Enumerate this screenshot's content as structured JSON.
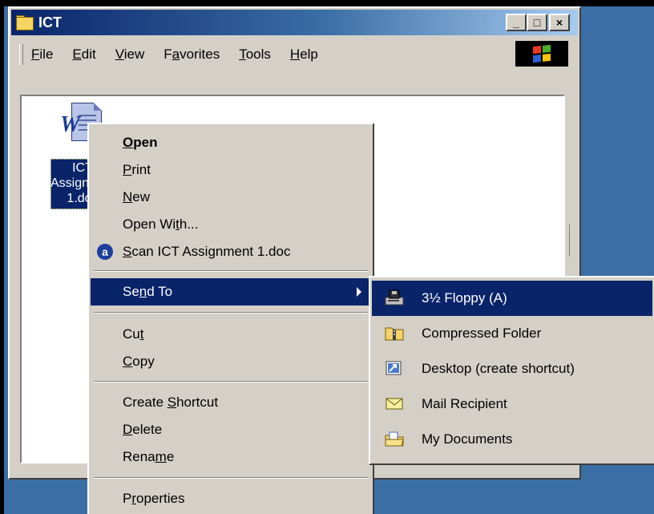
{
  "window": {
    "title": "ICT",
    "buttons": {
      "minimize": "_",
      "maximize": "□",
      "close": "×"
    }
  },
  "menubar": {
    "items": [
      {
        "pre": "",
        "acc": "F",
        "post": "ile"
      },
      {
        "pre": "",
        "acc": "E",
        "post": "dit"
      },
      {
        "pre": "",
        "acc": "V",
        "post": "iew"
      },
      {
        "pre": "F",
        "acc": "a",
        "post": "vorites"
      },
      {
        "pre": "",
        "acc": "T",
        "post": "ools"
      },
      {
        "pre": "",
        "acc": "H",
        "post": "elp"
      }
    ]
  },
  "file": {
    "label_lines": [
      "ICT",
      "Assignment",
      "1.doc"
    ],
    "icon": "word-document-icon"
  },
  "context_menu": {
    "items": [
      {
        "pre": "",
        "acc": "O",
        "post": "pen"
      },
      {
        "pre": "",
        "acc": "P",
        "post": "rint"
      },
      {
        "pre": "",
        "acc": "N",
        "post": "ew"
      },
      {
        "pre": "Open Wi",
        "acc": "t",
        "post": "h..."
      },
      {
        "pre": "",
        "acc": "S",
        "post": "can ICT Assignment 1.doc"
      },
      {
        "pre": "Se",
        "acc": "n",
        "post": "d To"
      },
      {
        "pre": "Cu",
        "acc": "t",
        "post": ""
      },
      {
        "pre": "",
        "acc": "C",
        "post": "opy"
      },
      {
        "pre": "Create ",
        "acc": "S",
        "post": "hortcut"
      },
      {
        "pre": "",
        "acc": "D",
        "post": "elete"
      },
      {
        "pre": "Rena",
        "acc": "m",
        "post": "e"
      },
      {
        "pre": "P",
        "acc": "r",
        "post": "operties"
      }
    ],
    "scan_icon_glyph": "a"
  },
  "send_to_menu": {
    "items": [
      {
        "label": "3½ Floppy (A)",
        "icon": "floppy-drive-icon"
      },
      {
        "label": "Compressed Folder",
        "icon": "zip-folder-icon"
      },
      {
        "label": "Desktop (create shortcut)",
        "icon": "desktop-icon"
      },
      {
        "label": "Mail Recipient",
        "icon": "envelope-icon"
      },
      {
        "label": "My Documents",
        "icon": "my-documents-folder-icon"
      }
    ]
  },
  "colors": {
    "highlight": "#0a246a",
    "face": "#d4d0c8",
    "desktop": "#3a6ea5"
  }
}
